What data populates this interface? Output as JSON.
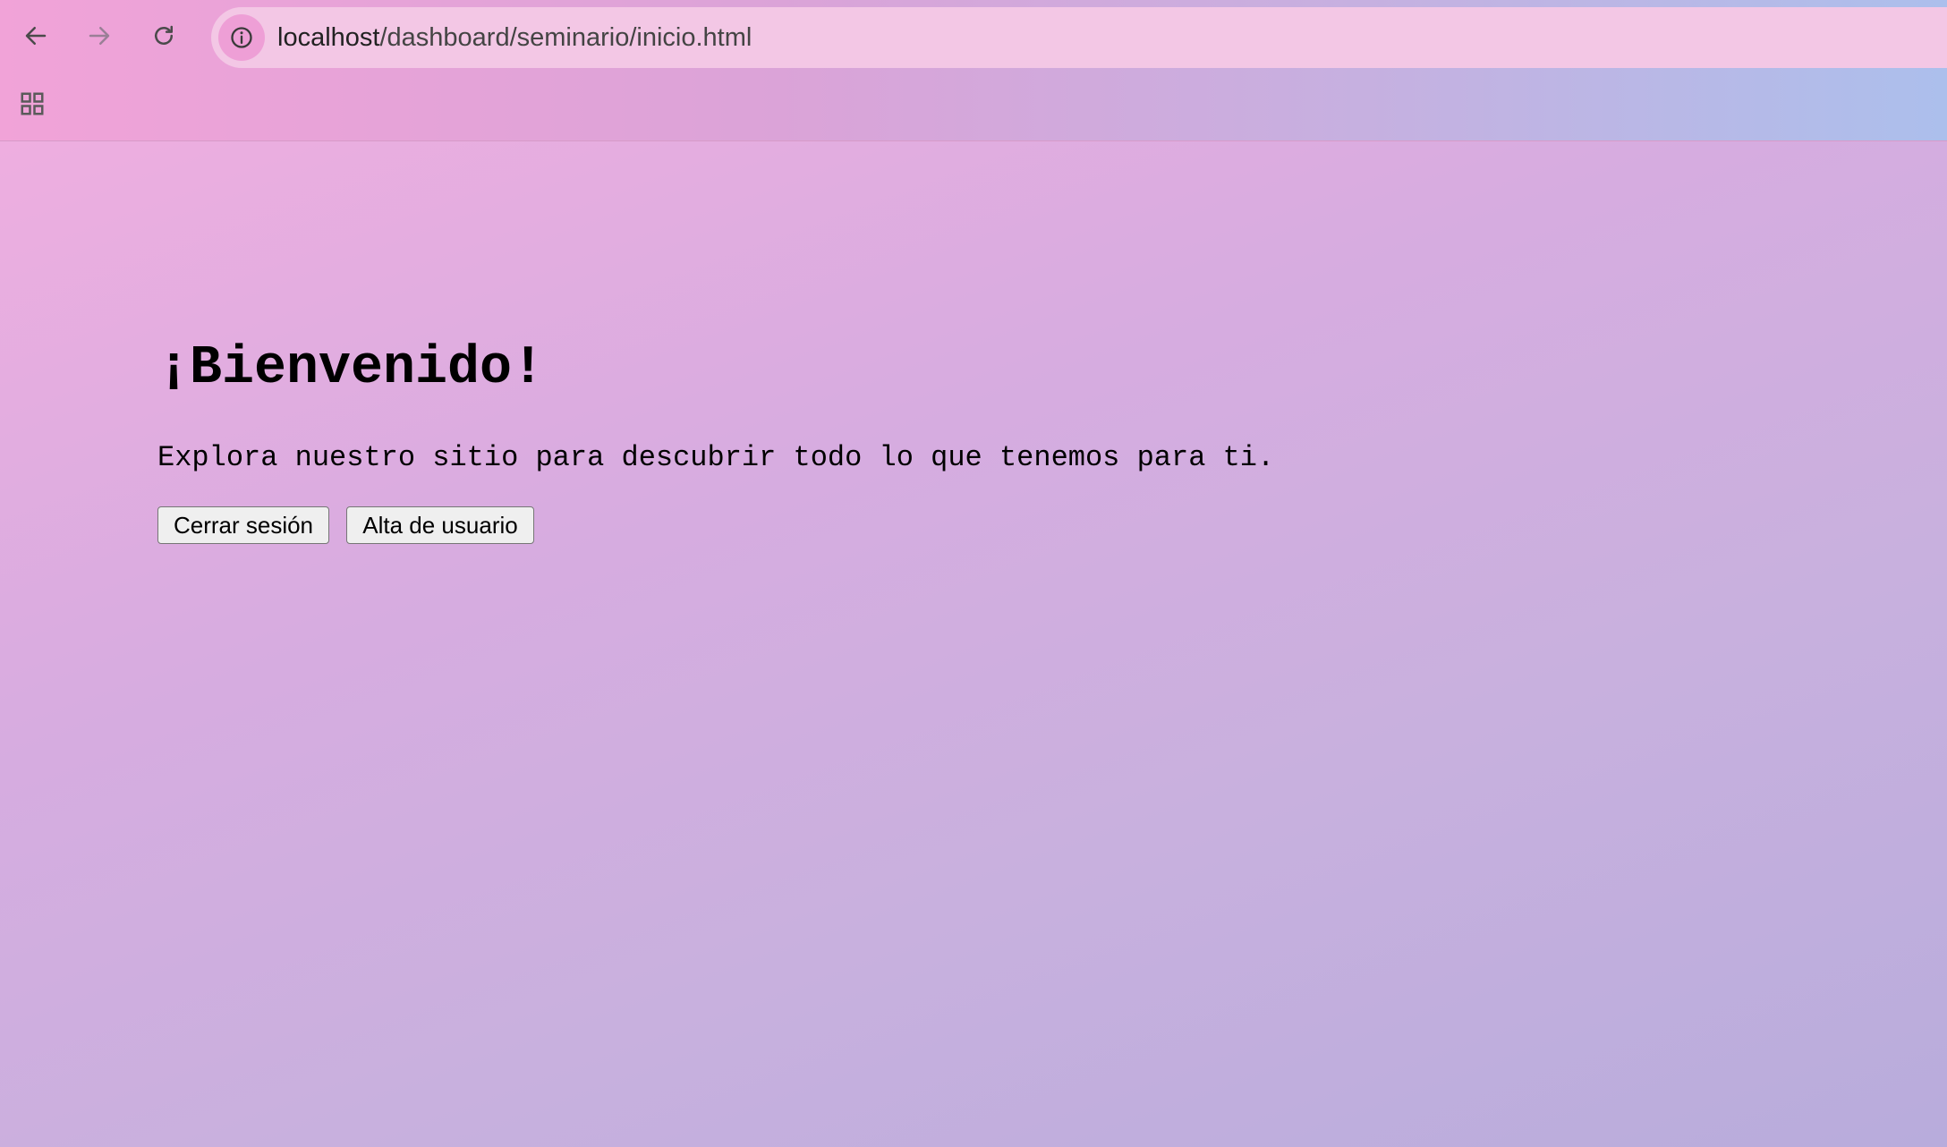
{
  "browser": {
    "url_host": "localhost",
    "url_path": "/dashboard/seminario/inicio.html"
  },
  "icons": {
    "back": "arrow-left-icon",
    "forward": "arrow-right-icon",
    "reload": "reload-icon",
    "site_info": "info-icon",
    "apps": "apps-grid-icon"
  },
  "colors": {
    "chrome_gradient_start": "#f1a3d8",
    "chrome_gradient_end": "#acbfec",
    "page_gradient_start": "#eeaee0",
    "page_gradient_end": "#b8acdc"
  },
  "main": {
    "title": "¡Bienvenido!",
    "subtitle": "Explora nuestro sitio para descubrir todo lo que tenemos para ti.",
    "logout_label": "Cerrar sesión",
    "signup_label": "Alta de usuario"
  }
}
